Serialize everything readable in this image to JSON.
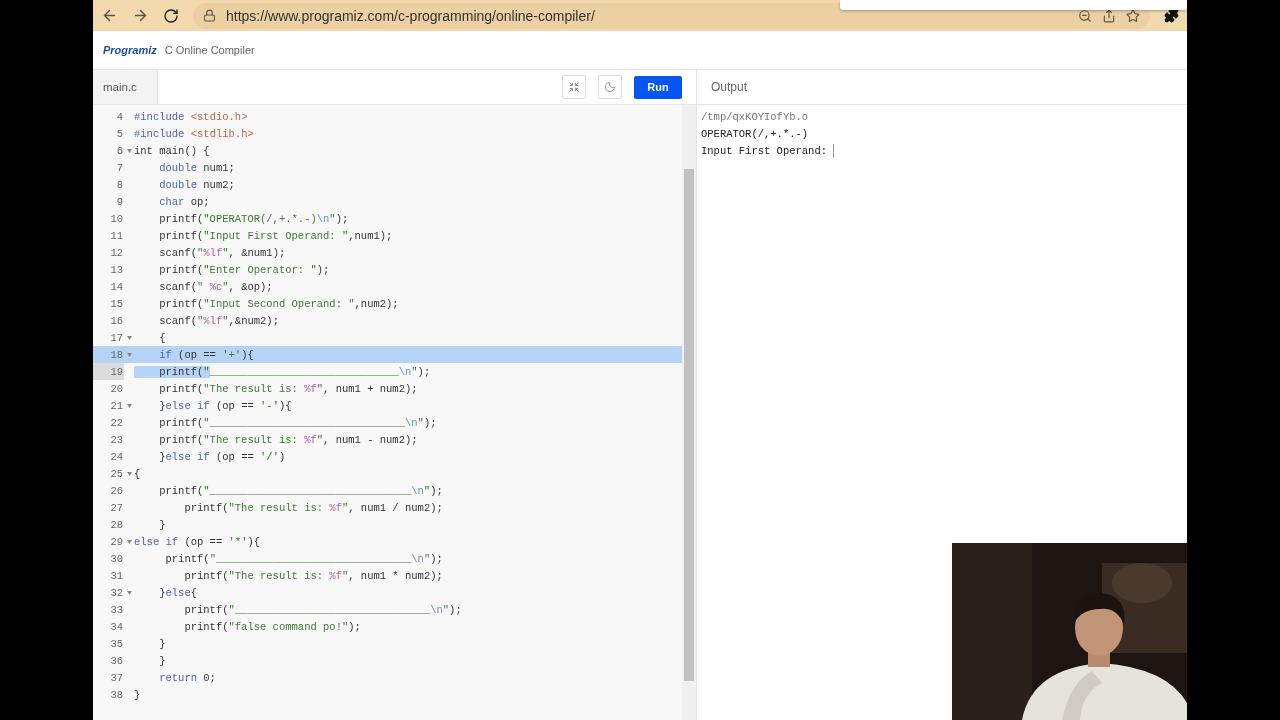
{
  "browser": {
    "url": "https://www.programiz.com/c-programming/online-compiler/"
  },
  "site": {
    "logo": "Programiz",
    "title": "C Online Compiler"
  },
  "editor": {
    "file_tab": "main.c",
    "run_button": "Run",
    "lines": [
      {
        "n": "4",
        "fold": false,
        "highlighted": false,
        "active": false,
        "segs": [
          {
            "kind": "kw",
            "text": "#include"
          },
          {
            "kind": "inc",
            "text": " <stdio.h>"
          }
        ]
      },
      {
        "n": "5",
        "fold": false,
        "highlighted": false,
        "active": false,
        "segs": [
          {
            "kind": "kw",
            "text": "#include"
          },
          {
            "kind": "inc",
            "text": " <stdlib.h>"
          }
        ]
      },
      {
        "n": "6",
        "fold": true,
        "highlighted": false,
        "active": false,
        "segs": [
          {
            "kind": "plain",
            "text": "int main() {"
          }
        ]
      },
      {
        "n": "7",
        "fold": false,
        "highlighted": false,
        "active": false,
        "segs": [
          {
            "kind": "kw",
            "text": "    double"
          },
          {
            "kind": "plain",
            "text": " num1;"
          }
        ]
      },
      {
        "n": "8",
        "fold": false,
        "highlighted": false,
        "active": false,
        "segs": [
          {
            "kind": "kw",
            "text": "    double"
          },
          {
            "kind": "plain",
            "text": " num2;"
          }
        ]
      },
      {
        "n": "9",
        "fold": false,
        "highlighted": false,
        "active": false,
        "segs": [
          {
            "kind": "kw",
            "text": "    char"
          },
          {
            "kind": "plain",
            "text": " op;"
          }
        ]
      },
      {
        "n": "10",
        "fold": false,
        "highlighted": false,
        "active": false,
        "segs": [
          {
            "kind": "plain",
            "text": "    printf("
          },
          {
            "kind": "str",
            "text": "\"OPERATOR(/,+.*.-)"
          },
          {
            "kind": "esc",
            "text": "\\n"
          },
          {
            "kind": "str",
            "text": "\""
          },
          {
            "kind": "plain",
            "text": ");"
          }
        ]
      },
      {
        "n": "11",
        "fold": false,
        "highlighted": false,
        "active": false,
        "segs": [
          {
            "kind": "plain",
            "text": "    printf("
          },
          {
            "kind": "str",
            "text": "\"Input First Operand: \""
          },
          {
            "kind": "plain",
            "text": ",num1);"
          }
        ]
      },
      {
        "n": "12",
        "fold": false,
        "highlighted": false,
        "active": false,
        "segs": [
          {
            "kind": "plain",
            "text": "    scanf("
          },
          {
            "kind": "str",
            "text": "\""
          },
          {
            "kind": "fmt",
            "text": "%lf"
          },
          {
            "kind": "str",
            "text": "\""
          },
          {
            "kind": "plain",
            "text": ", &num1);"
          }
        ]
      },
      {
        "n": "13",
        "fold": false,
        "highlighted": false,
        "active": false,
        "segs": [
          {
            "kind": "plain",
            "text": "    printf("
          },
          {
            "kind": "str",
            "text": "\"Enter Operator: \""
          },
          {
            "kind": "plain",
            "text": ");"
          }
        ]
      },
      {
        "n": "14",
        "fold": false,
        "highlighted": false,
        "active": false,
        "segs": [
          {
            "kind": "plain",
            "text": "    scanf("
          },
          {
            "kind": "str",
            "text": "\""
          },
          {
            "kind": "fmt",
            "text": " %c"
          },
          {
            "kind": "str",
            "text": "\""
          },
          {
            "kind": "plain",
            "text": ", &op);"
          }
        ]
      },
      {
        "n": "15",
        "fold": false,
        "highlighted": false,
        "active": false,
        "segs": [
          {
            "kind": "plain",
            "text": "    printf("
          },
          {
            "kind": "str",
            "text": "\"Input Second Operand: \""
          },
          {
            "kind": "plain",
            "text": ",num2);"
          }
        ]
      },
      {
        "n": "16",
        "fold": false,
        "highlighted": false,
        "active": false,
        "segs": [
          {
            "kind": "plain",
            "text": "    scanf("
          },
          {
            "kind": "str",
            "text": "\""
          },
          {
            "kind": "fmt",
            "text": "%lf"
          },
          {
            "kind": "str",
            "text": "\""
          },
          {
            "kind": "plain",
            "text": ",&num2);"
          }
        ]
      },
      {
        "n": "17",
        "fold": true,
        "highlighted": false,
        "active": false,
        "segs": [
          {
            "kind": "plain",
            "text": "    {"
          }
        ]
      },
      {
        "n": "18",
        "fold": true,
        "highlighted": true,
        "active": false,
        "segs": [
          {
            "kind": "kw",
            "text": "    if"
          },
          {
            "kind": "plain",
            "text": " (op == "
          },
          {
            "kind": "str",
            "text": "'+'"
          },
          {
            "kind": "plain",
            "text": "){"
          }
        ]
      },
      {
        "n": "19",
        "fold": false,
        "highlighted": true,
        "active": true,
        "segs": [
          {
            "kind": "plain",
            "text": "    printf("
          },
          {
            "kind": "str",
            "text": "\"______________________________"
          },
          {
            "kind": "esc",
            "text": "\\n"
          },
          {
            "kind": "str",
            "text": "\""
          },
          {
            "kind": "plain",
            "text": ");"
          }
        ]
      },
      {
        "n": "20",
        "fold": false,
        "highlighted": false,
        "active": false,
        "segs": [
          {
            "kind": "plain",
            "text": "    printf("
          },
          {
            "kind": "str",
            "text": "\"The result is: "
          },
          {
            "kind": "fmt",
            "text": "%f"
          },
          {
            "kind": "str",
            "text": "\""
          },
          {
            "kind": "plain",
            "text": ", num1 + num2);"
          }
        ]
      },
      {
        "n": "21",
        "fold": true,
        "highlighted": false,
        "active": false,
        "segs": [
          {
            "kind": "plain",
            "text": "    }"
          },
          {
            "kind": "kw",
            "text": "else if"
          },
          {
            "kind": "plain",
            "text": " (op == "
          },
          {
            "kind": "str",
            "text": "'-'"
          },
          {
            "kind": "plain",
            "text": "){"
          }
        ]
      },
      {
        "n": "22",
        "fold": false,
        "highlighted": false,
        "active": false,
        "segs": [
          {
            "kind": "plain",
            "text": "    printf("
          },
          {
            "kind": "str",
            "text": "\"_______________________________"
          },
          {
            "kind": "esc",
            "text": "\\n"
          },
          {
            "kind": "str",
            "text": "\""
          },
          {
            "kind": "plain",
            "text": ");"
          }
        ]
      },
      {
        "n": "23",
        "fold": false,
        "highlighted": false,
        "active": false,
        "segs": [
          {
            "kind": "plain",
            "text": "    printf("
          },
          {
            "kind": "str",
            "text": "\"The result is: "
          },
          {
            "kind": "fmt",
            "text": "%f"
          },
          {
            "kind": "str",
            "text": "\""
          },
          {
            "kind": "plain",
            "text": ", num1 - num2);"
          }
        ]
      },
      {
        "n": "24",
        "fold": false,
        "highlighted": false,
        "active": false,
        "segs": [
          {
            "kind": "plain",
            "text": "    }"
          },
          {
            "kind": "kw",
            "text": "else if"
          },
          {
            "kind": "plain",
            "text": " (op == "
          },
          {
            "kind": "str",
            "text": "'/'"
          },
          {
            "kind": "plain",
            "text": ")"
          }
        ]
      },
      {
        "n": "25",
        "fold": true,
        "highlighted": false,
        "active": false,
        "segs": [
          {
            "kind": "plain",
            "text": "{"
          }
        ]
      },
      {
        "n": "26",
        "fold": false,
        "highlighted": false,
        "active": false,
        "segs": [
          {
            "kind": "plain",
            "text": "    printf("
          },
          {
            "kind": "str",
            "text": "\"________________________________"
          },
          {
            "kind": "esc",
            "text": "\\n"
          },
          {
            "kind": "str",
            "text": "\""
          },
          {
            "kind": "plain",
            "text": ");"
          }
        ]
      },
      {
        "n": "27",
        "fold": false,
        "highlighted": false,
        "active": false,
        "segs": [
          {
            "kind": "plain",
            "text": "        printf("
          },
          {
            "kind": "str",
            "text": "\"The result is: "
          },
          {
            "kind": "fmt",
            "text": "%f"
          },
          {
            "kind": "str",
            "text": "\""
          },
          {
            "kind": "plain",
            "text": ", num1 / num2);"
          }
        ]
      },
      {
        "n": "28",
        "fold": false,
        "highlighted": false,
        "active": false,
        "segs": [
          {
            "kind": "plain",
            "text": "    }"
          }
        ]
      },
      {
        "n": "29",
        "fold": true,
        "highlighted": false,
        "active": false,
        "segs": [
          {
            "kind": "kw",
            "text": "else if"
          },
          {
            "kind": "plain",
            "text": " (op == "
          },
          {
            "kind": "str",
            "text": "'*'"
          },
          {
            "kind": "plain",
            "text": "){"
          }
        ]
      },
      {
        "n": "30",
        "fold": false,
        "highlighted": false,
        "active": false,
        "segs": [
          {
            "kind": "plain",
            "text": "     printf("
          },
          {
            "kind": "str",
            "text": "\"_______________________________"
          },
          {
            "kind": "esc",
            "text": "\\n"
          },
          {
            "kind": "str",
            "text": "\""
          },
          {
            "kind": "plain",
            "text": ");"
          }
        ]
      },
      {
        "n": "31",
        "fold": false,
        "highlighted": false,
        "active": false,
        "segs": [
          {
            "kind": "plain",
            "text": "        printf("
          },
          {
            "kind": "str",
            "text": "\"The result is: "
          },
          {
            "kind": "fmt",
            "text": "%f"
          },
          {
            "kind": "str",
            "text": "\""
          },
          {
            "kind": "plain",
            "text": ", num1 * num2);"
          }
        ]
      },
      {
        "n": "32",
        "fold": true,
        "highlighted": false,
        "active": false,
        "segs": [
          {
            "kind": "plain",
            "text": "    }"
          },
          {
            "kind": "kw",
            "text": "else"
          },
          {
            "kind": "plain",
            "text": "{"
          }
        ]
      },
      {
        "n": "33",
        "fold": false,
        "highlighted": false,
        "active": false,
        "segs": [
          {
            "kind": "plain",
            "text": "        printf("
          },
          {
            "kind": "str",
            "text": "\"_______________________________"
          },
          {
            "kind": "esc",
            "text": "\\n"
          },
          {
            "kind": "str",
            "text": "\""
          },
          {
            "kind": "plain",
            "text": ");"
          }
        ]
      },
      {
        "n": "34",
        "fold": false,
        "highlighted": false,
        "active": false,
        "segs": [
          {
            "kind": "plain",
            "text": "        printf("
          },
          {
            "kind": "str",
            "text": "\"false command po!\""
          },
          {
            "kind": "plain",
            "text": ");"
          }
        ]
      },
      {
        "n": "35",
        "fold": false,
        "highlighted": false,
        "active": false,
        "segs": [
          {
            "kind": "plain",
            "text": "    }"
          }
        ]
      },
      {
        "n": "36",
        "fold": false,
        "highlighted": false,
        "active": false,
        "segs": [
          {
            "kind": "plain",
            "text": "    }"
          }
        ]
      },
      {
        "n": "37",
        "fold": false,
        "highlighted": false,
        "active": false,
        "segs": [
          {
            "kind": "kw",
            "text": "    return"
          },
          {
            "kind": "plain",
            "text": " 0;"
          }
        ]
      },
      {
        "n": "38",
        "fold": false,
        "highlighted": false,
        "active": false,
        "segs": [
          {
            "kind": "plain",
            "text": "}"
          }
        ]
      }
    ]
  },
  "output": {
    "title": "Output",
    "lines": [
      {
        "kind": "path",
        "text": "/tmp/qxKOYIofYb.o"
      },
      {
        "kind": "text",
        "text": "OPERATOR(/,+.*.-)"
      },
      {
        "kind": "prompt",
        "text": "Input First Operand:"
      }
    ]
  }
}
